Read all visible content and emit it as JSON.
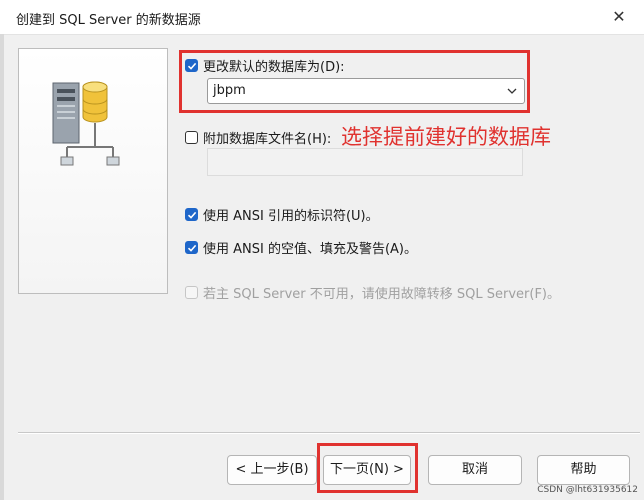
{
  "window": {
    "title": "创建到 SQL Server 的新数据源",
    "close_glyph": "✕"
  },
  "options": {
    "change_default_db": {
      "label": "更改默认的数据库为(D):",
      "checked": true
    },
    "database_select": {
      "value": "jbpm"
    },
    "attach_db_file": {
      "label": "附加数据库文件名(H):",
      "checked": false,
      "value": ""
    },
    "ansi_quoted": {
      "label": "使用 ANSI 引用的标识符(U)。",
      "checked": true
    },
    "ansi_nulls": {
      "label": "使用 ANSI 的空值、填充及警告(A)。",
      "checked": true
    },
    "failover": {
      "label": "若主 SQL Server 不可用，请使用故障转移 SQL Server(F)。",
      "checked": false,
      "enabled": false
    }
  },
  "annotation": {
    "text": "选择提前建好的数据库",
    "color": "#e0322f"
  },
  "buttons": {
    "back": "< 上一步(B)",
    "next": "下一页(N) >",
    "cancel": "取消",
    "help": "帮助"
  },
  "watermark": "CSDN @lht631935612",
  "icons": {
    "check": "checkmark-icon",
    "dropdown": "chevron-down-icon",
    "db": "database-server-icon"
  },
  "colors": {
    "accent": "#1e66c9",
    "highlight": "#e0322f"
  }
}
